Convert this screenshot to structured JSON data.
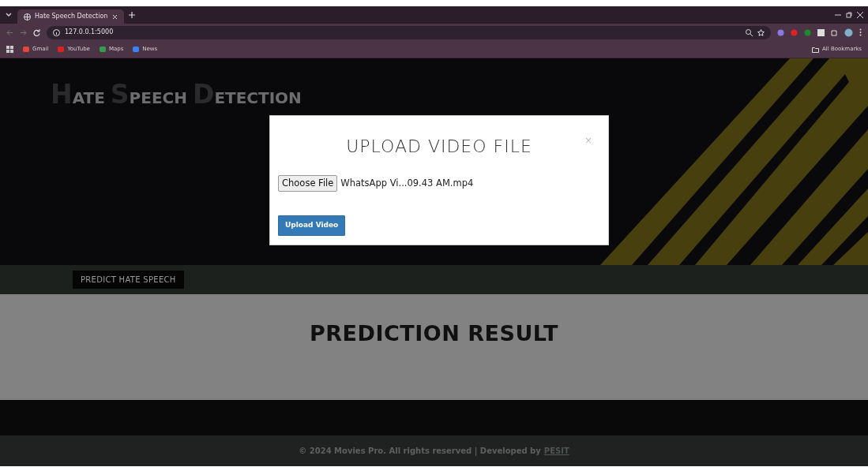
{
  "browser": {
    "tab_title": "Hate Speech Detection",
    "url": "127.0.0.1:5000",
    "bookmarks": [
      "Gmail",
      "YouTube",
      "Maps",
      "News"
    ],
    "all_bookmarks": "All Bookmarks"
  },
  "hero": {
    "title_words": [
      {
        "initial": "H",
        "rest": "ATE"
      },
      {
        "initial": "S",
        "rest": "PEECH"
      },
      {
        "initial": "D",
        "rest": "ETECTION"
      }
    ]
  },
  "nav_button": "PREDICT HATE SPEECH",
  "result": {
    "heading": "PREDICTION RESULT"
  },
  "footer": {
    "text": "© 2024 Movies Pro. All rights reserved | Developed by",
    "link": "PESIT"
  },
  "modal": {
    "title": "UPLOAD VIDEO FILE",
    "close": "×",
    "choose_button": "Choose File",
    "file_name": "WhatsApp Vi...09.43 AM.mp4",
    "submit": "Upload Video"
  }
}
